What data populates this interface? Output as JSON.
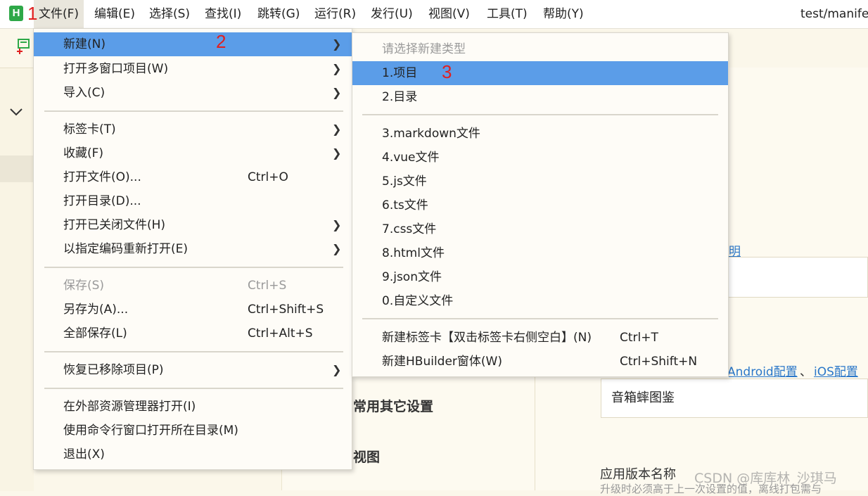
{
  "menubar": {
    "logo": "H",
    "items": [
      {
        "label": "文件(F)"
      },
      {
        "label": "编辑(E)"
      },
      {
        "label": "选择(S)"
      },
      {
        "label": "查找(I)"
      },
      {
        "label": "跳转(G)"
      },
      {
        "label": "运行(R)"
      },
      {
        "label": "发行(U)"
      },
      {
        "label": "视图(V)"
      },
      {
        "label": "工具(T)"
      },
      {
        "label": "帮助(Y)"
      }
    ],
    "window_title": "test/manife"
  },
  "annotations": [
    "1",
    "2",
    "3"
  ],
  "file_menu": {
    "items": [
      {
        "label": "新建(N)",
        "shortcut": ""
      },
      {
        "label": "打开多窗口项目(W)",
        "shortcut": ""
      },
      {
        "label": "导入(C)",
        "shortcut": ""
      },
      {
        "label": "标签卡(T)",
        "shortcut": ""
      },
      {
        "label": "收藏(F)",
        "shortcut": ""
      },
      {
        "label": "打开文件(O)...",
        "shortcut": "Ctrl+O"
      },
      {
        "label": "打开目录(D)...",
        "shortcut": ""
      },
      {
        "label": "打开已关闭文件(H)",
        "shortcut": ""
      },
      {
        "label": "以指定编码重新打开(E)",
        "shortcut": ""
      },
      {
        "label": "保存(S)",
        "shortcut": "Ctrl+S",
        "disabled": true
      },
      {
        "label": "另存为(A)...",
        "shortcut": "Ctrl+Shift+S"
      },
      {
        "label": "全部保存(L)",
        "shortcut": "Ctrl+Alt+S"
      },
      {
        "label": "恢复已移除项目(P)",
        "shortcut": ""
      },
      {
        "label": "在外部资源管理器打开(I)",
        "shortcut": ""
      },
      {
        "label": "使用命令行窗口打开所在目录(M)",
        "shortcut": ""
      },
      {
        "label": "退出(X)",
        "shortcut": ""
      }
    ]
  },
  "new_submenu": {
    "header": "请选择新建类型",
    "items": [
      {
        "label": "1.项目",
        "shortcut": ""
      },
      {
        "label": "2.目录",
        "shortcut": ""
      },
      {
        "label": "3.markdown文件",
        "shortcut": ""
      },
      {
        "label": "4.vue文件",
        "shortcut": ""
      },
      {
        "label": "5.js文件",
        "shortcut": ""
      },
      {
        "label": "6.ts文件",
        "shortcut": ""
      },
      {
        "label": "7.css文件",
        "shortcut": ""
      },
      {
        "label": "8.html文件",
        "shortcut": ""
      },
      {
        "label": "9.json文件",
        "shortcut": ""
      },
      {
        "label": "0.自定义文件",
        "shortcut": ""
      },
      {
        "label": "新建标签卡【双击标签卡右侧空白】(N)",
        "shortcut": "Ctrl+T"
      },
      {
        "label": "新建HBuilder窗体(W)",
        "shortcut": "Ctrl+Shift+N"
      }
    ]
  },
  "background": {
    "link_partial": "明",
    "link_android": "Android配置",
    "link_sep": "、",
    "link_ios": "iOS配置",
    "app_name_value": "音箱蟀图鉴",
    "heading_other": "常用其它设置",
    "heading_view": "视图",
    "label_version_name": "应用版本名称",
    "version_hint": "升级时必须高于上一次设置的值，离线打包需与",
    "watermark": "CSDN @库库林_沙琪马"
  },
  "colors": {
    "highlight": "#5b9de8",
    "annotation": "#e02020",
    "logo": "#2ea848",
    "link": "#2a77c9"
  }
}
